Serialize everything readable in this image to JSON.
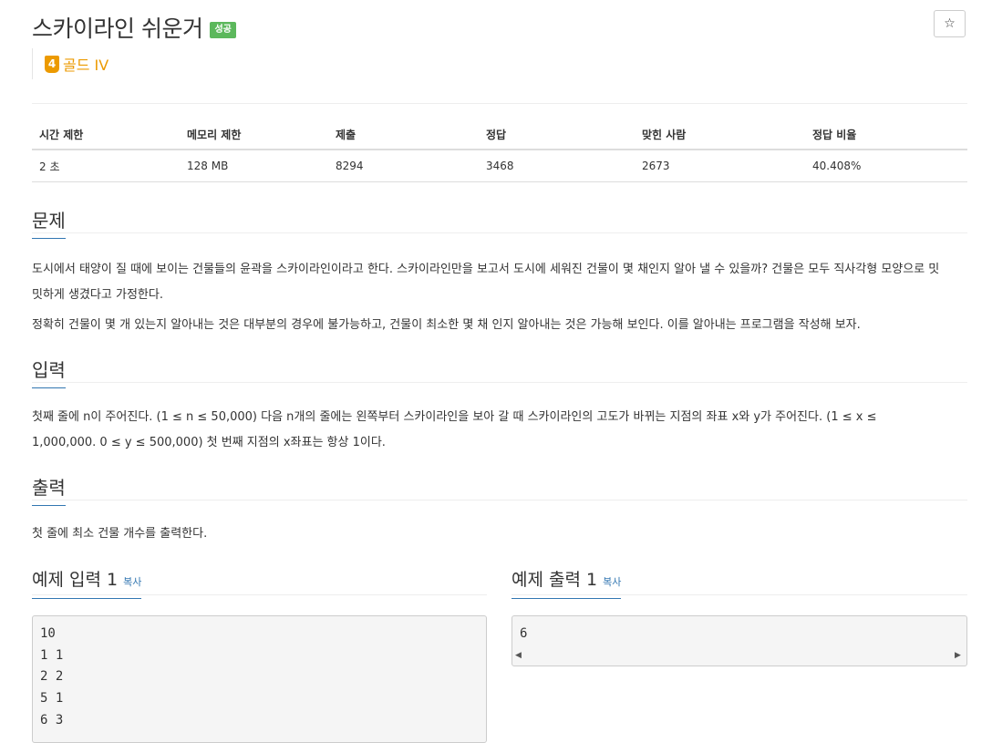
{
  "problem": {
    "title": "스카이라인 쉬운거",
    "status_badge": "성공",
    "star_icon": "☆",
    "tier": {
      "number": "4",
      "label": "골드 IV",
      "color": "#ec9a00"
    }
  },
  "info_table": {
    "headers": [
      "시간 제한",
      "메모리 제한",
      "제출",
      "정답",
      "맞힌 사람",
      "정답 비율"
    ],
    "values": [
      "2 초",
      "128 MB",
      "8294",
      "3468",
      "2673",
      "40.408%"
    ]
  },
  "sections": {
    "problem": {
      "title": "문제",
      "paragraphs": [
        "도시에서 태양이 질 때에 보이는 건물들의 윤곽을 스카이라인이라고 한다. 스카이라인만을 보고서 도시에 세워진 건물이 몇 채인지 알아 낼 수 있을까? 건물은 모두 직사각형 모양으로 밋밋하게 생겼다고 가정한다.",
        "정확히 건물이 몇 개 있는지 알아내는 것은 대부분의 경우에 불가능하고, 건물이 최소한 몇 채 인지 알아내는 것은 가능해 보인다. 이를 알아내는 프로그램을 작성해 보자."
      ]
    },
    "input": {
      "title": "입력",
      "text": "첫째 줄에 n이 주어진다. (1 ≤ n ≤ 50,000) 다음 n개의 줄에는 왼쪽부터 스카이라인을 보아 갈 때 스카이라인의 고도가 바뀌는 지점의 좌표 x와 y가 주어진다. (1 ≤ x ≤ 1,000,000. 0 ≤ y ≤ 500,000) 첫 번째 지점의 x좌표는 항상 1이다."
    },
    "output": {
      "title": "출력",
      "text": "첫 줄에 최소 건물 개수를 출력한다."
    }
  },
  "samples": {
    "input_title": "예제 입력 1",
    "output_title": "예제 출력 1",
    "copy_label": "복사",
    "input_lines": [
      "10",
      "1 1",
      "2 2",
      "5 1",
      "6 3"
    ],
    "output_lines": [
      "6"
    ]
  },
  "colors": {
    "success": "#5cb85c",
    "link": "#3276b1"
  }
}
